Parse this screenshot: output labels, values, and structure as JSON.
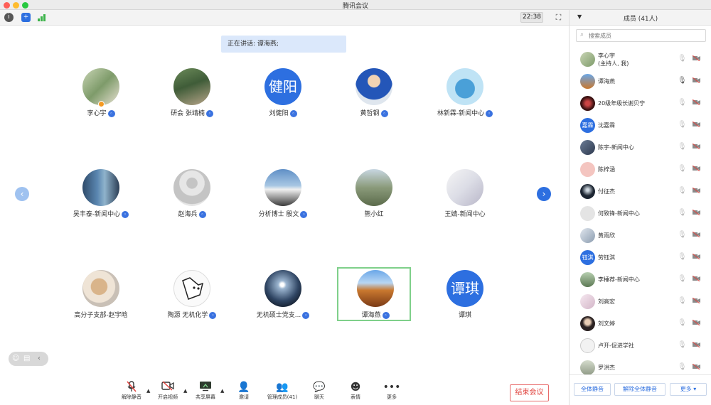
{
  "window": {
    "title": "腾讯会议"
  },
  "topbar": {
    "time": "22:38"
  },
  "speaking": {
    "text": "正在讲话: 谭海燕;"
  },
  "grid": [
    {
      "name": "李心宇",
      "avatar": "photo",
      "host": true,
      "badge": true
    },
    {
      "name": "研会 张靖楠",
      "avatar": "photo",
      "badge": true
    },
    {
      "name": "刘健阳",
      "avatar": "text",
      "avatar_text": "健阳",
      "badge": true
    },
    {
      "name": "黄哲钢",
      "avatar": "photo",
      "badge": true
    },
    {
      "name": "林新霖-新闻中心",
      "avatar": "photo",
      "badge": true
    },
    {
      "name": "吴丰泰-新闻中心",
      "avatar": "photo",
      "badge": true
    },
    {
      "name": "赵海兵",
      "avatar": "default",
      "badge": true
    },
    {
      "name": "分析博士 殷文",
      "avatar": "photo",
      "badge": true
    },
    {
      "name": "熊小红",
      "avatar": "photo",
      "badge": false
    },
    {
      "name": "王婧-新闻中心",
      "avatar": "photo",
      "badge": false
    },
    {
      "name": "高分子支部-赵宇晗",
      "avatar": "photo",
      "badge": false
    },
    {
      "name": "陶源 无机化学",
      "avatar": "photo",
      "badge": true
    },
    {
      "name": "无机硕士党支...",
      "avatar": "photo",
      "badge": true
    },
    {
      "name": "谭海燕",
      "avatar": "photo",
      "badge": true,
      "active": true
    },
    {
      "name": "谭琪",
      "avatar": "text",
      "avatar_text": "谭琪",
      "badge": false
    }
  ],
  "controls": {
    "unmute": "解除静音",
    "video": "开启视频",
    "share": "共享屏幕",
    "invite": "邀请",
    "members": "管理成员(41)",
    "chat": "聊天",
    "emoji": "表情",
    "more": "更多",
    "end": "结束会议"
  },
  "panel": {
    "title": "成员 (41人)",
    "search_placeholder": "搜索成员",
    "members": [
      {
        "name": "李心宇",
        "sub": "(主持人, 我)",
        "avatar": "photo"
      },
      {
        "name": "谭海燕",
        "avatar": "photo",
        "speaking": true
      },
      {
        "name": "20级年级长谢贝宁",
        "avatar": "photo"
      },
      {
        "name": "沈嘉霖",
        "avatar": "text",
        "avatar_text": "嘉霖"
      },
      {
        "name": "陈宇-新闻中心",
        "avatar": "photo"
      },
      {
        "name": "陈梓涵",
        "avatar": "photo"
      },
      {
        "name": "付征杰",
        "avatar": "photo"
      },
      {
        "name": "何致锋-新闻中心",
        "avatar": "photo"
      },
      {
        "name": "黄雨欣",
        "avatar": "photo"
      },
      {
        "name": "劳钰淇",
        "avatar": "text",
        "avatar_text": "钰淇"
      },
      {
        "name": "李棰荐-新闻中心",
        "avatar": "photo"
      },
      {
        "name": "刘高宏",
        "avatar": "photo"
      },
      {
        "name": "刘文婷",
        "avatar": "photo"
      },
      {
        "name": "卢开-促进学社",
        "avatar": "photo"
      },
      {
        "name": "罗洪杰",
        "avatar": "photo"
      }
    ],
    "mute_all": "全体静音",
    "unmute_all": "解除全体静音",
    "more": "更多"
  },
  "colors": {
    "accent": "#2d6fe0",
    "end": "#e0433e",
    "active_border": "#7fd08a"
  }
}
